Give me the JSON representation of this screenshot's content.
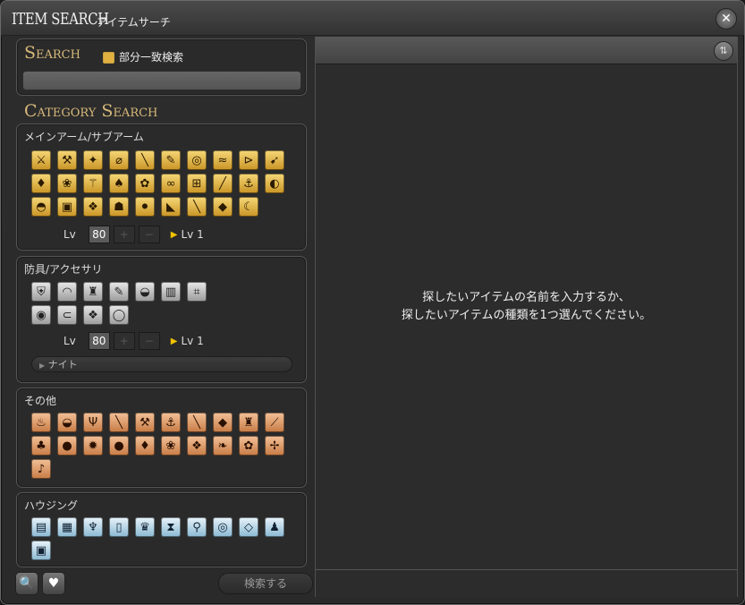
{
  "window": {
    "title_en": "ITEM SEARCH",
    "title_jp": "アイテムサーチ",
    "close_icon": "close-icon"
  },
  "search": {
    "title": "Search",
    "partial_match_label": "部分一致検索",
    "input_value": ""
  },
  "category": {
    "title": "Category Search"
  },
  "weapons": {
    "label": "メインアーム/サブアーム",
    "lv_label": "Lv",
    "lv_value": "80",
    "plus": "+",
    "minus": "−",
    "lv_arrow": "▶",
    "lv_min": "Lv 1",
    "icons": [
      "⚔",
      "⚒",
      "✦",
      "⌀",
      "╲",
      "✎",
      "◎",
      "≈",
      "⊳",
      "➹",
      "♦",
      "❀",
      "⚚",
      "♠",
      "✿",
      "∞",
      "⊞",
      "╱",
      "⚓",
      "◐",
      "◓",
      "▣",
      "❖",
      "☗",
      "⚫",
      "◣",
      "╲",
      "◆",
      "☾"
    ]
  },
  "armor": {
    "label": "防具/アクセサリ",
    "lv_label": "Lv",
    "lv_value": "80",
    "plus": "+",
    "minus": "−",
    "lv_arrow": "▶",
    "lv_min": "Lv 1",
    "job_select": "ナイト",
    "icons": [
      "⛨",
      "◠",
      "♜",
      "✎",
      "◒",
      "▥",
      "⌗",
      "◉",
      "⊂",
      "❖",
      "◯"
    ]
  },
  "other": {
    "label": "その他",
    "icons": [
      "♨",
      "◒",
      "Ψ",
      "╲",
      "⚒",
      "⚓",
      "╲",
      "◆",
      "♜",
      "⟋",
      "♣",
      "●",
      "✹",
      "●",
      "♦",
      "❀",
      "❖",
      "❧",
      "✿",
      "✢",
      "♪"
    ]
  },
  "housing": {
    "label": "ハウジング",
    "icons": [
      "▤",
      "▦",
      "♆",
      "▯",
      "♛",
      "⧗",
      "⚲",
      "◎",
      "◇",
      "♟",
      "▣"
    ]
  },
  "bottom": {
    "search_icon": "🔍",
    "favorite_icon": "♥",
    "search_button": "検索する"
  },
  "results": {
    "sort_icon": "⇅",
    "message_line1": "探したいアイテムの名前を入力するか、",
    "message_line2": "探したいアイテムの種類を1つ選んでください。"
  },
  "colors": {
    "accent": "#d8b97a",
    "checkbox": "#e0b040"
  }
}
